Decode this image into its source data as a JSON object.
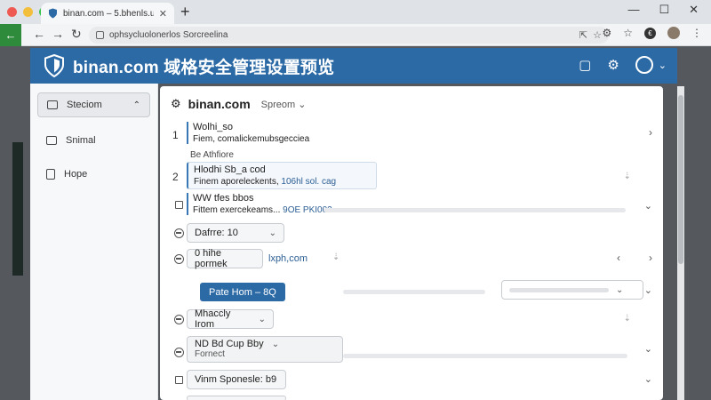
{
  "browser": {
    "tab_title": "binan.com – 5.bhenls.uk",
    "url": "ophsycluolonerlos Sorcreelina",
    "new_tab_glyph": "+",
    "window_controls": [
      "—",
      "☐",
      "✕"
    ]
  },
  "app": {
    "title": "binan.com 域格安全管理设置预览",
    "brand_color": "#2c6aa6"
  },
  "sidebar": {
    "items": [
      {
        "label": "Steciom",
        "icon": "calendar-icon"
      },
      {
        "label": "Snimal",
        "icon": "window-icon"
      },
      {
        "label": "Hope",
        "icon": "file-icon"
      }
    ]
  },
  "panel": {
    "title": "binan.com",
    "select": "Spreom"
  },
  "rows": [
    {
      "index": "1",
      "title": "Wolhi_so",
      "subtitle": "Fiem, comalickemubsgecciea"
    },
    {
      "section_label": "Be Athfiore"
    },
    {
      "index": "2",
      "title": "Hlodhi Sb_a cod",
      "subtitle": "Finem aporeleckents,",
      "link": "106hl sol. cag"
    },
    {
      "title": "WW tfes bbos",
      "subtitle": "Fittem exercekeams...",
      "link": "9OE PKI002"
    },
    {
      "select_value": "Dafrre: 10"
    },
    {
      "select_value": "0 hihe pormek",
      "link": "lxph,com"
    },
    {
      "button_label": "Pate Hom – 8Q"
    },
    {
      "select_value": "Mhaccly Irom"
    },
    {
      "select_title": "ND Bd Cup Bby",
      "select_sub": "Fornect"
    },
    {
      "select_value": "Vinm Sponesle: b9"
    }
  ]
}
